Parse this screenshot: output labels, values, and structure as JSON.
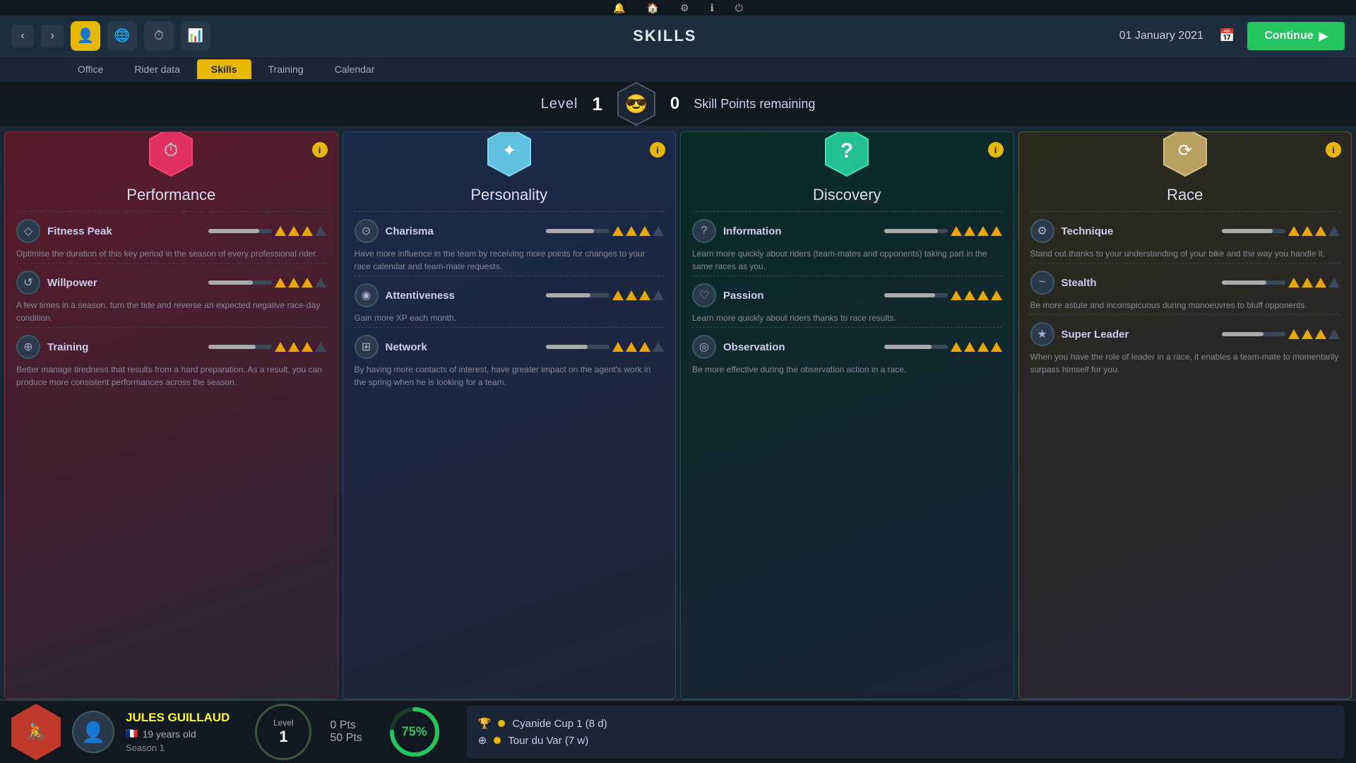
{
  "topbar": {
    "icons": [
      "bell",
      "home",
      "gear",
      "info",
      "power"
    ]
  },
  "navbar": {
    "title": "SKILLS",
    "date": "01 January 2021",
    "continue_label": "Continue"
  },
  "tabs": [
    {
      "label": "Office",
      "active": false
    },
    {
      "label": "Rider data",
      "active": false
    },
    {
      "label": "Skills",
      "active": true
    },
    {
      "label": "Training",
      "active": false
    },
    {
      "label": "Calendar",
      "active": false
    }
  ],
  "level_bar": {
    "level_label": "Level",
    "level_value": "1",
    "skill_points": "0",
    "skill_points_label": "Skill Points remaining"
  },
  "cards": [
    {
      "id": "performance",
      "title": "Performance",
      "icon_color": "#e03060",
      "icon_char": "⏱",
      "skills": [
        {
          "name": "Fitness Peak",
          "icon": "◇",
          "triangles": 3,
          "bar_pct": 80,
          "desc": "Optimise the duration of this key period in the season of every professional rider."
        },
        {
          "name": "Willpower",
          "icon": "↺",
          "triangles": 3,
          "bar_pct": 70,
          "desc": "A few times in a season, turn the tide and reverse an expected negative race-day condition."
        },
        {
          "name": "Training",
          "icon": "⊕",
          "triangles": 3,
          "bar_pct": 75,
          "desc": "Better manage tiredness that results from a hard preparation. As a result, you can produce more consistent performances across the season."
        }
      ]
    },
    {
      "id": "personality",
      "title": "Personality",
      "icon_color": "#60c0e0",
      "icon_char": "✦",
      "skills": [
        {
          "name": "Charisma",
          "icon": "⊙",
          "triangles": 3,
          "bar_pct": 75,
          "desc": "Have more influence in the team by receiving more points for changes to your race calendar and team-mate requests."
        },
        {
          "name": "Attentiveness",
          "icon": "◉",
          "triangles": 3,
          "bar_pct": 70,
          "desc": "Gain more XP each month."
        },
        {
          "name": "Network",
          "icon": "⊞",
          "triangles": 3,
          "bar_pct": 65,
          "desc": "By having more contacts of interest, have greater impact on the agent's work in the spring when he is looking for a team."
        }
      ]
    },
    {
      "id": "discovery",
      "title": "Discovery",
      "icon_color": "#22c090",
      "icon_char": "?",
      "skills": [
        {
          "name": "Information",
          "icon": "?",
          "triangles": 4,
          "bar_pct": 85,
          "desc": "Learn more quickly about riders (team-mates and opponents) taking part in the same races as you."
        },
        {
          "name": "Passion",
          "icon": "♡",
          "triangles": 4,
          "bar_pct": 80,
          "desc": "Learn more quickly about riders thanks to race results."
        },
        {
          "name": "Observation",
          "icon": "◎",
          "triangles": 4,
          "bar_pct": 75,
          "desc": "Be more effective during the observation action in a race."
        }
      ]
    },
    {
      "id": "race",
      "title": "Race",
      "icon_color": "#c0a060",
      "icon_char": "⟳",
      "skills": [
        {
          "name": "Technique",
          "icon": "⚙",
          "triangles": 3,
          "bar_pct": 80,
          "desc": "Stand out thanks to your understanding of your bike and the way you handle it."
        },
        {
          "name": "Stealth",
          "icon": "~",
          "triangles": 3,
          "bar_pct": 70,
          "desc": "Be more astute and inconspicuous during manoeuvres to bluff opponents."
        },
        {
          "name": "Super Leader",
          "icon": "★",
          "triangles": 3,
          "bar_pct": 65,
          "desc": "When you have the role of leader in a race, it enables a team-mate to momentarily surpass himself for you."
        }
      ]
    }
  ],
  "bottom": {
    "rider_name": "JULES GUILLAUD",
    "rider_age": "19 years old",
    "rider_season": "Season 1",
    "level_label": "Level",
    "level_value": "1",
    "pts_current": "0 Pts",
    "pts_total": "50 Pts",
    "progress_pct": "75%",
    "races": [
      {
        "icon": "🏆",
        "label": "Cyanide Cup 1 (8 d)"
      },
      {
        "icon": "⊕",
        "label": "Tour du Var (7 w)"
      }
    ]
  }
}
